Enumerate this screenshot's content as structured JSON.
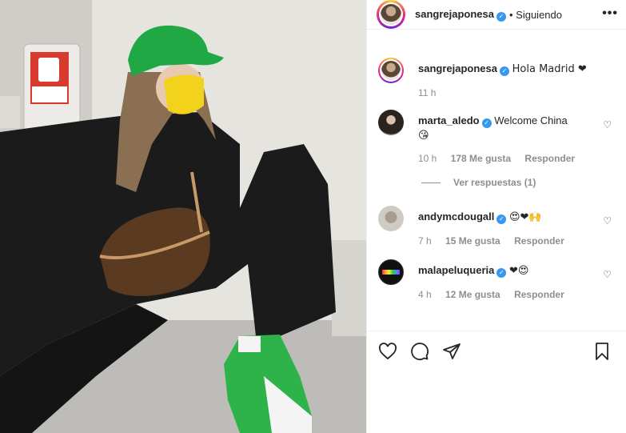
{
  "post": {
    "username": "sangrejaponesa",
    "follow_status": "• Siguiendo",
    "more_label": "•••"
  },
  "caption": {
    "username": "sangrejaponesa",
    "text": "Hola Madrid ❤",
    "time": "11 h"
  },
  "comments": [
    {
      "username": "marta_aledo",
      "verified": true,
      "text": "Welcome China",
      "text2": "😘",
      "time": "10 h",
      "likes": "178 Me gusta",
      "reply": "Responder",
      "replies": "Ver respuestas (1)"
    },
    {
      "username": "andymcdougall",
      "verified": true,
      "text": "😍❤🙌",
      "time": "7 h",
      "likes": "15 Me gusta",
      "reply": "Responder"
    },
    {
      "username": "malapeluqueria",
      "verified": true,
      "text": "❤😍",
      "time": "4 h",
      "likes": "12 Me gusta",
      "reply": "Responder"
    }
  ],
  "icons": [
    "heart-icon",
    "comment-icon",
    "share-icon",
    "bookmark-icon"
  ],
  "colors": {
    "verified": "#3897f0",
    "hat": "#1fa844",
    "mask": "#f2d21a",
    "shoe": "#2db34a",
    "seat": "#2a6fd6"
  }
}
